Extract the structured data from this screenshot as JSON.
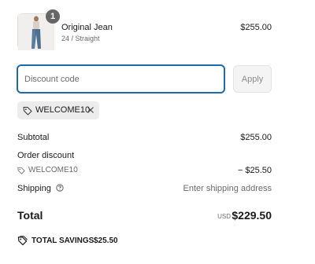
{
  "product": {
    "name": "Original Jean",
    "variant": "24 / Straight",
    "price": "$255.00",
    "quantity": "1"
  },
  "discount": {
    "placeholder": "Discount code",
    "apply_label": "Apply",
    "applied_code": "WELCOME10"
  },
  "summary": {
    "subtotal_label": "Subtotal",
    "subtotal_value": "$255.00",
    "order_discount_label": "Order discount",
    "discount_code": "WELCOME10",
    "discount_value": "− $25.50",
    "shipping_label": "Shipping",
    "shipping_value": "Enter shipping address",
    "total_label": "Total",
    "currency": "USD",
    "total_value": "$229.50",
    "savings_label": "TOTAL SAVINGS",
    "savings_value": "$25.50"
  },
  "icons": {
    "tag": "tag-icon",
    "remove": "close-icon",
    "help": "help-circle-icon",
    "savings": "tag-icon"
  },
  "colors": {
    "focus_border": "#1f6aa8",
    "badge": "#666666",
    "chip_bg": "#ececec"
  }
}
